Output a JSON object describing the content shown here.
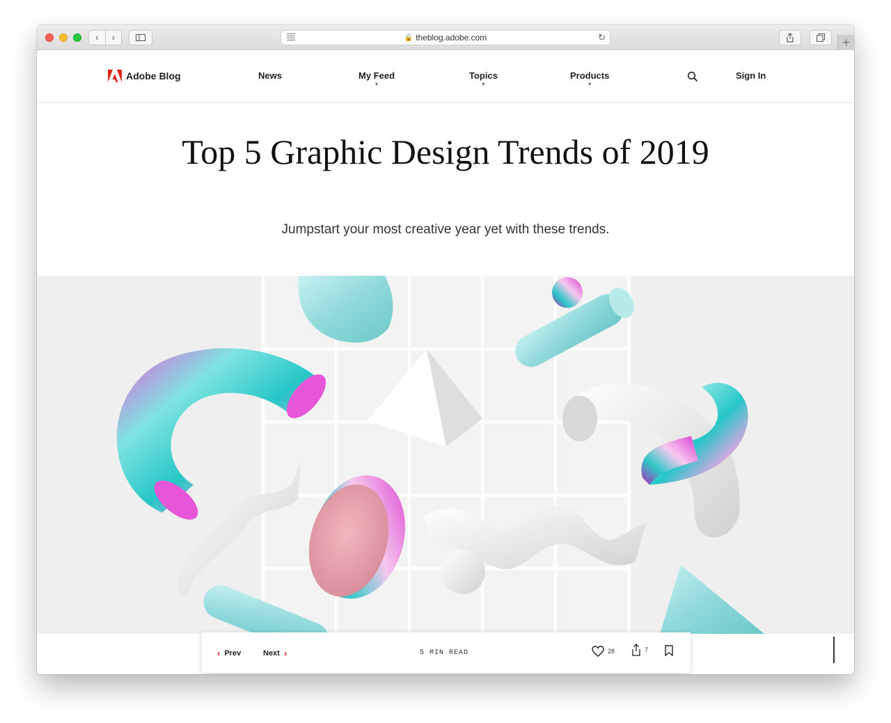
{
  "browser": {
    "url": "theblog.adobe.com",
    "back_icon": "chevron-left-icon",
    "forward_icon": "chevron-right-icon",
    "plus": "+"
  },
  "header": {
    "brand": "Adobe Blog",
    "nav": [
      "News",
      "My Feed",
      "Topics",
      "Products"
    ],
    "sign_in": "Sign In",
    "accent": "#e1251b"
  },
  "article": {
    "title": "Top 5 Graphic Design Trends of 2019",
    "subtitle": "Jumpstart your most creative year yet with these trends.",
    "hero_icon": "abstract-3d-shapes-image"
  },
  "bar": {
    "prev": "Prev",
    "next": "Next",
    "read_time": "5 MIN READ",
    "likes": "28",
    "shares": "7"
  }
}
